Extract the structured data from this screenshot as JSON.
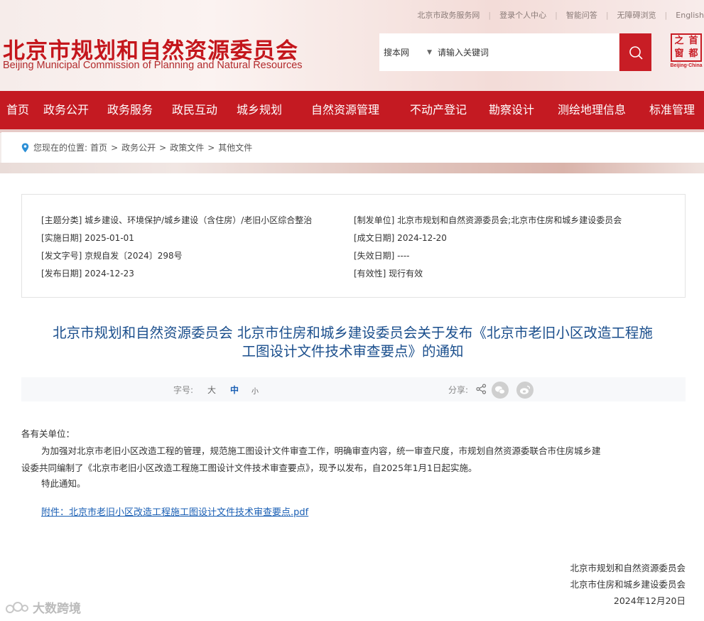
{
  "top_links": [
    "北京市政务服务网",
    "登录个人中心",
    "智能问答",
    "无障碍浏览",
    "English"
  ],
  "header": {
    "title_cn": "北京市规划和自然资源委员会",
    "title_en": "Beijing Municipal Commission of Planning and Natural Resources",
    "badge_chars": [
      "之",
      "首",
      "窗",
      "都"
    ],
    "badge_en": "Beijing·China"
  },
  "search": {
    "scope": "搜本网",
    "placeholder": "请输入关键词"
  },
  "nav": [
    "首页",
    "政务公开",
    "政务服务",
    "政民互动",
    "城乡规划",
    "自然资源管理",
    "不动产登记",
    "勘察设计",
    "测绘地理信息",
    "标准管理"
  ],
  "breadcrumb": {
    "prefix": "您现在的位置:",
    "items": [
      "首页",
      "政务公开",
      "政策文件",
      "其他文件"
    ],
    "separator": ">"
  },
  "meta": {
    "subject": "[主题分类] 城乡建设、环境保护/城乡建设（含住房）/老旧小区综合整治",
    "issuer": "[制发单位] 北京市规划和自然资源委员会;北京市住房和城乡建设委员会",
    "effective_date": "[实施日期] 2025-01-01",
    "formed_date": "[成文日期] 2024-12-20",
    "doc_number": "[发文字号] 京规自发〔2024〕298号",
    "expire_date": "[失效日期] ----",
    "publish_date": "[发布日期] 2024-12-23",
    "validity": "[有效性] 现行有效"
  },
  "article": {
    "title_line1": "北京市规划和自然资源委员会 北京市住房和城乡建设委员会关于发布《北京市老旧小区改造工程施",
    "title_line2": "工图设计文件技术审查要点》的通知",
    "font_size_label": "字号:",
    "font_sizes": [
      "大",
      "中",
      "小"
    ],
    "share_label": "分享:",
    "share_icons": [
      "share-icon",
      "wechat-icon",
      "weibo-icon"
    ],
    "salutation": "各有关单位：",
    "paragraph_line1": "为加强对北京市老旧小区改造工程的管理，规范施工图设计文件审查工作，明确审查内容，统一审查尺度，市规划自然资源委联合市住房城乡建",
    "paragraph_line2": "设委共同编制了《北京市老旧小区改造工程施工图设计文件技术审查要点》，现予以发布，自2025年1月1日起实施。",
    "closing": "特此通知。",
    "attachment": "附件：北京市老旧小区改造工程施工图设计文件技术审查要点.pdf",
    "signer1": "北京市规划和自然资源委员会",
    "signer2": "北京市住房和城乡建设委员会",
    "date": "2024年12月20日"
  },
  "watermark": "大数跨境",
  "colors": {
    "brand_red": "#c41a22",
    "title_blue": "#1a4e8c",
    "link_blue": "#1a5fb4"
  }
}
